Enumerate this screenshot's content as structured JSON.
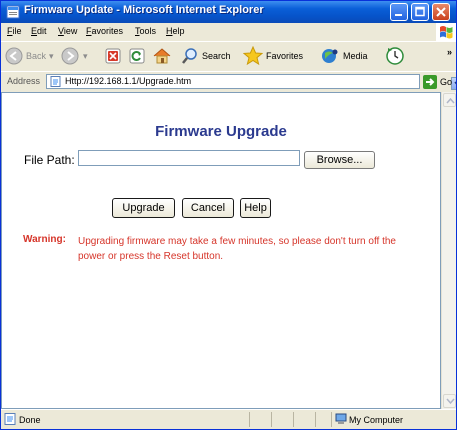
{
  "window": {
    "title": "Firmware Update - Microsoft Internet Explorer"
  },
  "menu": {
    "items": [
      "File",
      "Edit",
      "View",
      "Favorites",
      "Tools",
      "Help"
    ]
  },
  "toolbar": {
    "back_label": "Back",
    "search_label": "Search",
    "favorites_label": "Favorites",
    "media_label": "Media",
    "overflow_glyph": "»"
  },
  "address": {
    "label": "Address",
    "value": "Http://192.168.1.1/Upgrade.htm",
    "go_label": "Go"
  },
  "page": {
    "title": "Firmware Upgrade",
    "file_path_label": "File Path:",
    "file_path_value": "",
    "browse_label": "Browse...",
    "upgrade_label": "Upgrade",
    "cancel_label": "Cancel",
    "help_label": "Help",
    "warning_label": "Warning:",
    "warning_text": "Upgrading firmware may take a few minutes, so please don't turn off the power or press the Reset button."
  },
  "status": {
    "text": "Done",
    "zone": "My Computer"
  },
  "colors": {
    "title_blue": "#2b3a8f",
    "warning_red": "#d6352a",
    "titlebar_blue": "#0653c9"
  }
}
